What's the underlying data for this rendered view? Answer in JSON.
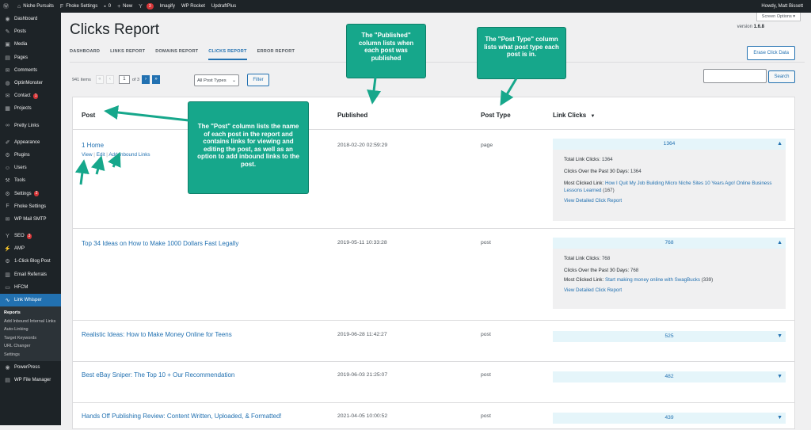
{
  "adminbar": {
    "site_name": "Niche Pursuits",
    "fhoke_settings": "Fhoke Settings",
    "comments_count": "0",
    "new_label": "New",
    "yoast_count": "3",
    "imagify": "Imagify",
    "wp_rocket": "WP Rocket",
    "updraft": "UpdraftPlus",
    "greeting": "Howdy, Matt Bissett"
  },
  "sidebar": {
    "items": [
      {
        "label": "Dashboard",
        "icon": "dashboard-icon",
        "glyph": "◉"
      },
      {
        "label": "Posts",
        "icon": "pin-icon",
        "glyph": "✎"
      },
      {
        "label": "Media",
        "icon": "media-icon",
        "glyph": "▣"
      },
      {
        "label": "Pages",
        "icon": "pages-icon",
        "glyph": "▤"
      },
      {
        "label": "Comments",
        "icon": "comments-icon",
        "glyph": "✉"
      },
      {
        "label": "OptinMonster",
        "icon": "optinmonster-icon",
        "glyph": "◍"
      },
      {
        "label": "Contact",
        "icon": "contact-icon",
        "glyph": "✉",
        "badge": "1"
      },
      {
        "label": "Projects",
        "icon": "projects-icon",
        "glyph": "▦"
      }
    ],
    "items2": [
      {
        "label": "Pretty Links",
        "icon": "link-icon",
        "glyph": "∞"
      }
    ],
    "items3": [
      {
        "label": "Appearance",
        "icon": "appearance-icon",
        "glyph": "✐"
      },
      {
        "label": "Plugins",
        "icon": "plugins-icon",
        "glyph": "⚙"
      },
      {
        "label": "Users",
        "icon": "users-icon",
        "glyph": "☺"
      },
      {
        "label": "Tools",
        "icon": "tools-icon",
        "glyph": "⚒"
      },
      {
        "label": "Settings",
        "icon": "settings-icon",
        "glyph": "⚙",
        "badge": "2"
      },
      {
        "label": "Fhoke Settings",
        "icon": "fhoke-icon",
        "glyph": "F"
      },
      {
        "label": "WP Mail SMTP",
        "icon": "mail-icon",
        "glyph": "✉"
      }
    ],
    "items4": [
      {
        "label": "SEO",
        "icon": "yoast-icon",
        "glyph": "Y",
        "badge": "3"
      },
      {
        "label": "AMP",
        "icon": "amp-icon",
        "glyph": "⚡"
      },
      {
        "label": "1-Click Blog Post",
        "icon": "blogpost-icon",
        "glyph": "⚙"
      },
      {
        "label": "Email Referrals",
        "icon": "referrals-icon",
        "glyph": "▥"
      },
      {
        "label": "HFCM",
        "icon": "hfcm-icon",
        "glyph": "▭"
      },
      {
        "label": "Link Whisper",
        "icon": "linkwhisper-icon",
        "glyph": "∿"
      }
    ],
    "submenu": [
      "Reports",
      "Add Inbound Internal Links",
      "Auto-Linking",
      "Target Keywords",
      "URL Changer",
      "Settings"
    ],
    "items5": [
      {
        "label": "PowerPress",
        "icon": "powerpress-icon",
        "glyph": "◉"
      },
      {
        "label": "WP File Manager",
        "icon": "filemanager-icon",
        "glyph": "▤"
      }
    ]
  },
  "page": {
    "screen_options": "Screen Options ▾",
    "title": "Clicks Report",
    "version_label": "version",
    "version": "1.6.8",
    "tabs": [
      "DASHBOARD",
      "LINKS REPORT",
      "DOMAINS REPORT",
      "CLICKS REPORT",
      "ERROR REPORT"
    ],
    "erase_btn": "Erase Click Data",
    "items_count": "941 items",
    "page_current": "1",
    "page_of": "of 3",
    "post_type_select": "All Post Types",
    "filter_btn": "Filter",
    "search_btn": "Search"
  },
  "table": {
    "headers": {
      "post": "Post",
      "published": "Published",
      "post_type": "Post Type",
      "link_clicks": "Link Clicks",
      "sort_indicator": "▼"
    },
    "rows": [
      {
        "title": "1 Home",
        "actions": [
          "View",
          "Edit",
          "Add Inbound Links"
        ],
        "published": "2018-02-20 02:59:29",
        "type": "page",
        "clicks": "1364",
        "expanded": true,
        "total_label": "Total Link Clicks:",
        "total": "1364",
        "past30_label": "Clicks Over the Past 30 Days:",
        "past30": "1364",
        "most_label": "Most Clicked Link:",
        "most_link": "How I Quit My Job Building Micro Niche Sites 10 Years Ago! Online Business Lessons Learned",
        "most_count": "(167)",
        "detail": "View Detailed Click Report"
      },
      {
        "title": "Top 34 Ideas on How to Make 1000 Dollars Fast Legally",
        "published": "2019-05-11 10:33:28",
        "type": "post",
        "clicks": "768",
        "expanded": true,
        "total_label": "Total Link Clicks:",
        "total": "768",
        "past30_label": "Clicks Over the Past 30 Days:",
        "past30": "768",
        "most_label": "Most Clicked Link:",
        "most_link": "Start making money online with SwagBucks",
        "most_count": "(339)",
        "detail": "View Detailed Click Report"
      },
      {
        "title": "Realistic Ideas: How to Make Money Online for Teens",
        "published": "2019-06-28 11:42:27",
        "type": "post",
        "clicks": "525"
      },
      {
        "title": "Best eBay Sniper: The Top 10 + Our Recommendation",
        "published": "2019-06-03 21:25:07",
        "type": "post",
        "clicks": "482"
      },
      {
        "title": "Hands Off Publishing Review: Content Written, Uploaded, & Formatted!",
        "published": "2021-04-05 10:00:52",
        "type": "post",
        "clicks": "439"
      }
    ]
  },
  "callouts": {
    "published": "The \"Published\" column lists when each post was published",
    "post_type": "The \"Post Type\" column lists what post type each post is in.",
    "post": "The \"Post\" column lists the name of each post in the report and contains links for viewing and editing the post, as well as an option to add inbound links to the post."
  },
  "colors": {
    "accent": "#2271b1",
    "callout": "#16a78b",
    "admin_dark": "#1d2327",
    "badge": "#d63638"
  }
}
